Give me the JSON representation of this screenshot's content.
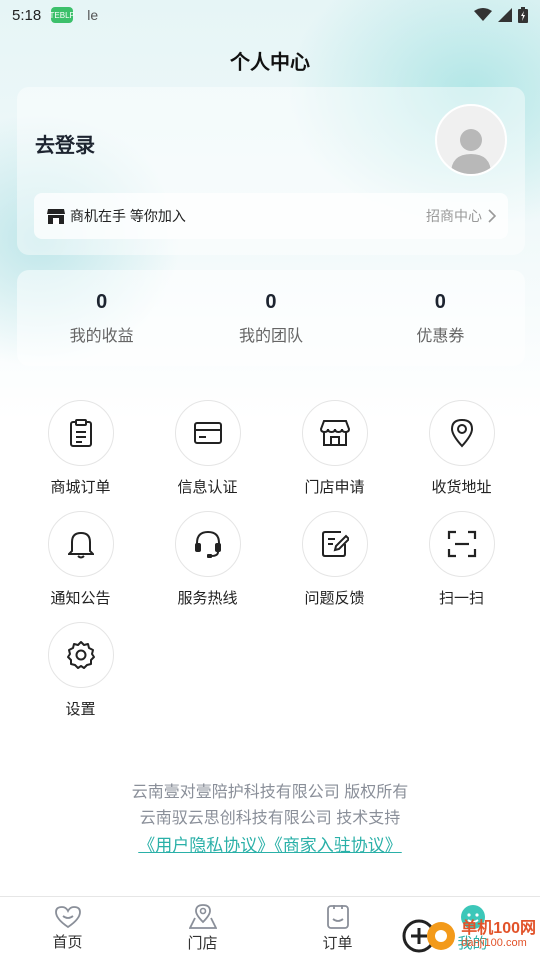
{
  "status_bar": {
    "time": "5:18",
    "app_badge": "TEBLP",
    "carrier": "le"
  },
  "header": {
    "title": "个人中心"
  },
  "profile": {
    "login_text": "去登录",
    "merchant_text": "商机在手 等你加入",
    "merchant_link": "招商中心"
  },
  "stats": [
    {
      "value": "0",
      "label": "我的收益"
    },
    {
      "value": "0",
      "label": "我的团队"
    },
    {
      "value": "0",
      "label": "优惠券"
    }
  ],
  "menu": [
    {
      "label": "商城订单",
      "icon": "clipboard-icon"
    },
    {
      "label": "信息认证",
      "icon": "card-icon"
    },
    {
      "label": "门店申请",
      "icon": "store-icon"
    },
    {
      "label": "收货地址",
      "icon": "location-icon"
    },
    {
      "label": "通知公告",
      "icon": "bell-icon"
    },
    {
      "label": "服务热线",
      "icon": "headset-icon"
    },
    {
      "label": "问题反馈",
      "icon": "feedback-icon"
    },
    {
      "label": "扫一扫",
      "icon": "scan-icon"
    },
    {
      "label": "设置",
      "icon": "gear-icon"
    }
  ],
  "footer": {
    "copyright": "云南壹对壹陪护科技有限公司 版权所有",
    "support": "云南驭云思创科技有限公司 技术支持",
    "links": "《用户隐私协议》《商家入驻协议》"
  },
  "tabs": [
    {
      "label": "首页",
      "icon": "home-heart-icon"
    },
    {
      "label": "门店",
      "icon": "map-pin-icon"
    },
    {
      "label": "订单",
      "icon": "order-icon"
    },
    {
      "label": "我的",
      "icon": "profile-smile-icon"
    }
  ],
  "watermark": {
    "main": "单机100网",
    "sub": "danji100.com"
  },
  "colors": {
    "accent": "#2ab0a8",
    "text": "#1d2430",
    "muted": "#8a8f99"
  }
}
